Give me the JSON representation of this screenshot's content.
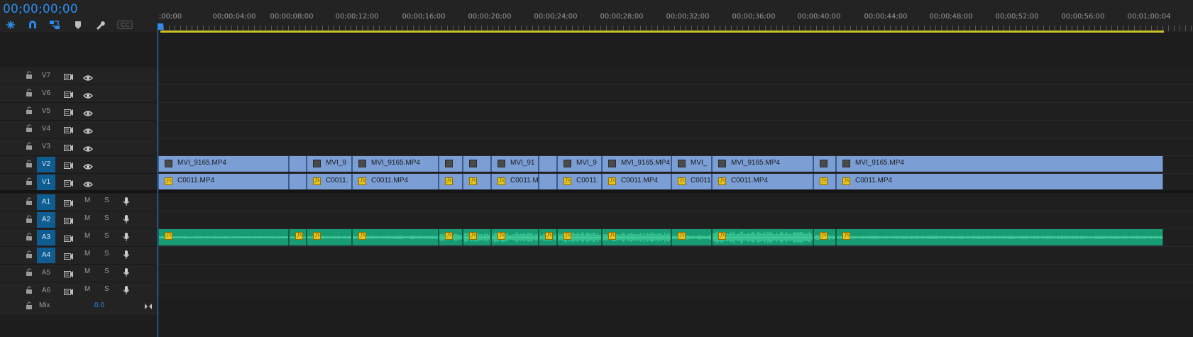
{
  "timecode": "00;00;00;00",
  "tools": [
    {
      "name": "insert-overwrite-icon"
    },
    {
      "name": "snap-icon"
    },
    {
      "name": "linked-selection-icon"
    },
    {
      "name": "add-marker-icon"
    },
    {
      "name": "timeline-settings-icon"
    },
    {
      "name": "captions-icon",
      "label": "CC"
    }
  ],
  "ruler": {
    "labels": [
      ";00;00",
      "00;00;04;00",
      "00;00;08;00",
      "00;00;12;00",
      "00;00;16;00",
      "00;00;20;00",
      "00;00;24;00",
      "00;00;28;00",
      "00;00;32;00",
      "00;00;36;00",
      "00;00;40;00",
      "00;00;44;00",
      "00;00;48;00",
      "00;00;52;00",
      "00;00;56;00",
      "00;01;00;04"
    ]
  },
  "video_tracks": [
    {
      "name": "V7",
      "active": false
    },
    {
      "name": "V6",
      "active": false
    },
    {
      "name": "V5",
      "active": false
    },
    {
      "name": "V4",
      "active": false
    },
    {
      "name": "V3",
      "active": false
    },
    {
      "name": "V2",
      "active": true
    },
    {
      "name": "V1",
      "active": true
    }
  ],
  "audio_tracks": [
    {
      "name": "A1",
      "active": true,
      "m": "M",
      "s": "S"
    },
    {
      "name": "A2",
      "active": true,
      "m": "M",
      "s": "S"
    },
    {
      "name": "A3",
      "active": true,
      "m": "M",
      "s": "S"
    },
    {
      "name": "A4",
      "active": true,
      "m": "M",
      "s": "S"
    },
    {
      "name": "A5",
      "active": false,
      "m": "M",
      "s": "S"
    },
    {
      "name": "A6",
      "active": false,
      "m": "M",
      "s": "S"
    }
  ],
  "mix": {
    "label": "Mix",
    "value": "0.0"
  },
  "v2_clips": [
    {
      "label": "MVI_9165.MP4"
    },
    {
      "label": ""
    },
    {
      "label": "MVI_9"
    },
    {
      "label": "MVI_9165.MP4"
    },
    {
      "label": ""
    },
    {
      "label": ""
    },
    {
      "label": "MVI_91"
    },
    {
      "label": ""
    },
    {
      "label": "MVI_9"
    },
    {
      "label": "MVI_9165.MP4"
    },
    {
      "label": "MVI_"
    },
    {
      "label": "MVI_9165.MP4"
    },
    {
      "label": ""
    },
    {
      "label": "MVI_9165.MP4"
    }
  ],
  "v1_clips": [
    {
      "label": "C0011.MP4"
    },
    {
      "label": ""
    },
    {
      "label": "C0011."
    },
    {
      "label": "C0011.MP4"
    },
    {
      "label": ""
    },
    {
      "label": ""
    },
    {
      "label": "C0011.M"
    },
    {
      "label": ""
    },
    {
      "label": "C0011."
    },
    {
      "label": "C0011.MP4"
    },
    {
      "label": "C0011"
    },
    {
      "label": "C0011.MP4"
    },
    {
      "label": ""
    },
    {
      "label": "C0011.MP4"
    }
  ],
  "colors": {
    "accent": "#2d8ceb",
    "video_clip": "#7b9ed5",
    "audio_clip": "#189a72",
    "fx_badge": "#e7c21b",
    "work_area": "#c9c12a"
  }
}
